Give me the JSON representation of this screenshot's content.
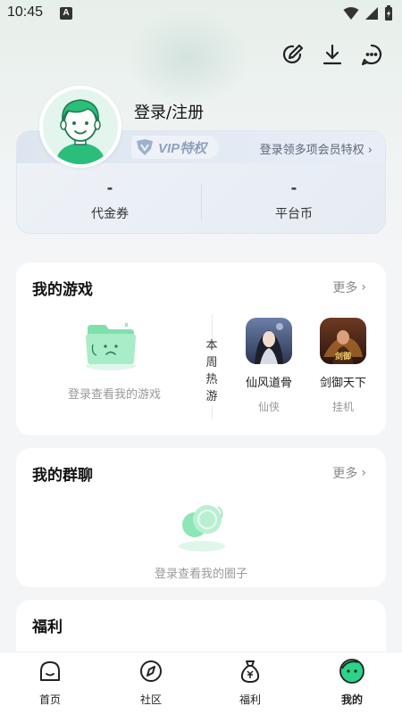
{
  "status_bar": {
    "time": "10:45",
    "notification_badge": "A"
  },
  "header": {
    "icons": [
      "edit-icon",
      "download-icon",
      "message-icon"
    ]
  },
  "profile": {
    "login_label": "登录/注册",
    "vip_badge": "VIP特权",
    "vip_link": "登录领多项会员特权",
    "vip_chevron": "›",
    "stats": [
      {
        "value": "-",
        "label": "代金券"
      },
      {
        "value": "-",
        "label": "平台币"
      }
    ]
  },
  "my_games": {
    "title": "我的游戏",
    "more": "更多",
    "chevron": "›",
    "empty_text": "登录查看我的游戏",
    "hot_label": "本周热游",
    "hot_games": [
      {
        "name": "仙风道骨",
        "tag": "仙侠"
      },
      {
        "name": "剑御天下",
        "tag": "挂机"
      }
    ]
  },
  "my_groups": {
    "title": "我的群聊",
    "more": "更多",
    "chevron": "›",
    "empty_text": "登录查看我的圈子"
  },
  "welfare": {
    "title": "福利"
  },
  "bottom_nav": [
    {
      "label": "首页",
      "icon": "home-icon"
    },
    {
      "label": "社区",
      "icon": "compass-icon"
    },
    {
      "label": "福利",
      "icon": "money-bag-icon"
    },
    {
      "label": "我的",
      "icon": "profile-face-icon",
      "active": true
    }
  ],
  "colors": {
    "accent_green": "#2bd48a",
    "text_muted": "#999999"
  }
}
